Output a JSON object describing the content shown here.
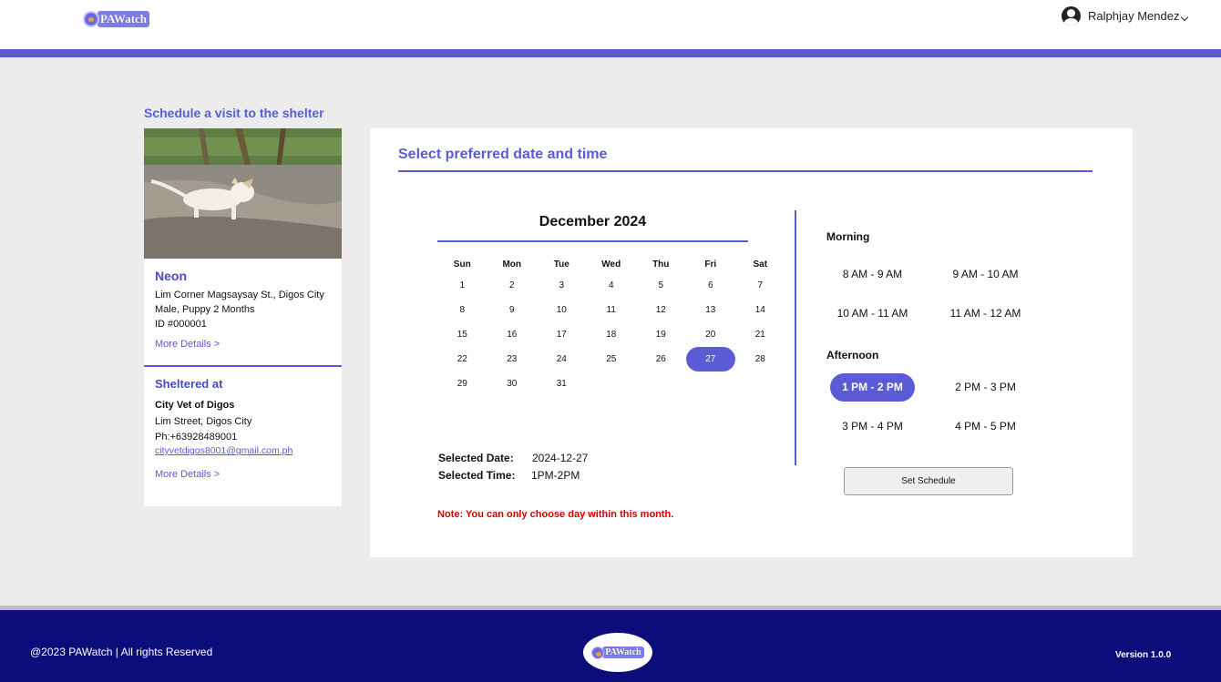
{
  "header": {
    "logo_text": "PAWatch",
    "user_name": "Ralphjay Mendez",
    "accent": "#5b5bd6"
  },
  "pet": {
    "section_title": "Schedule a visit to the shelter",
    "name": "Neon",
    "address": "Lim Corner Magsaysay St., Digos City",
    "details": "Male, Puppy 2 Months",
    "id": "ID #000001",
    "more_details": "More Details >"
  },
  "shelter": {
    "title": "Sheltered at",
    "name": "City Vet of Digos",
    "address": "Lim Street, Digos City",
    "phone": "Ph:+63928489001",
    "email": "cityvetdigos8001@gmail.com.ph",
    "more_details": "More Details >"
  },
  "scheduler": {
    "title": "Select preferred date and time",
    "month": "December 2024",
    "weekdays": [
      "Sun",
      "Mon",
      "Tue",
      "Wed",
      "Thu",
      "Fri",
      "Sat"
    ],
    "weeks": [
      [
        "1",
        "2",
        "3",
        "4",
        "5",
        "6",
        "7"
      ],
      [
        "8",
        "9",
        "10",
        "11",
        "12",
        "13",
        "14"
      ],
      [
        "15",
        "16",
        "17",
        "18",
        "19",
        "20",
        "21"
      ],
      [
        "22",
        "23",
        "24",
        "25",
        "26",
        "27",
        "28"
      ],
      [
        "29",
        "30",
        "31",
        "",
        "",
        "",
        ""
      ]
    ],
    "selected_day": "27",
    "selected_date_label": "Selected Date:",
    "selected_date": "2024-12-27",
    "selected_time_label": "Selected Time:",
    "selected_time": "1PM-2PM",
    "note": "Note: You can only choose day within this month.",
    "morning_label": "Morning",
    "morning_slots": [
      "8 AM - 9 AM",
      "9 AM - 10 AM",
      "10 AM - 11 AM",
      "11 AM - 12 AM"
    ],
    "afternoon_label": "Afternoon",
    "afternoon_slots": [
      "1 PM - 2 PM",
      "2 PM - 3 PM",
      "3 PM - 4 PM",
      "4 PM - 5 PM"
    ],
    "active_slot": "1 PM - 2 PM",
    "set_button": "Set Schedule"
  },
  "footer": {
    "copyright": "@2023 PAWatch | All rights Reserved",
    "logo_text": "PAWatch",
    "version": "Version 1.0.0",
    "background": "#0c0c7a"
  }
}
